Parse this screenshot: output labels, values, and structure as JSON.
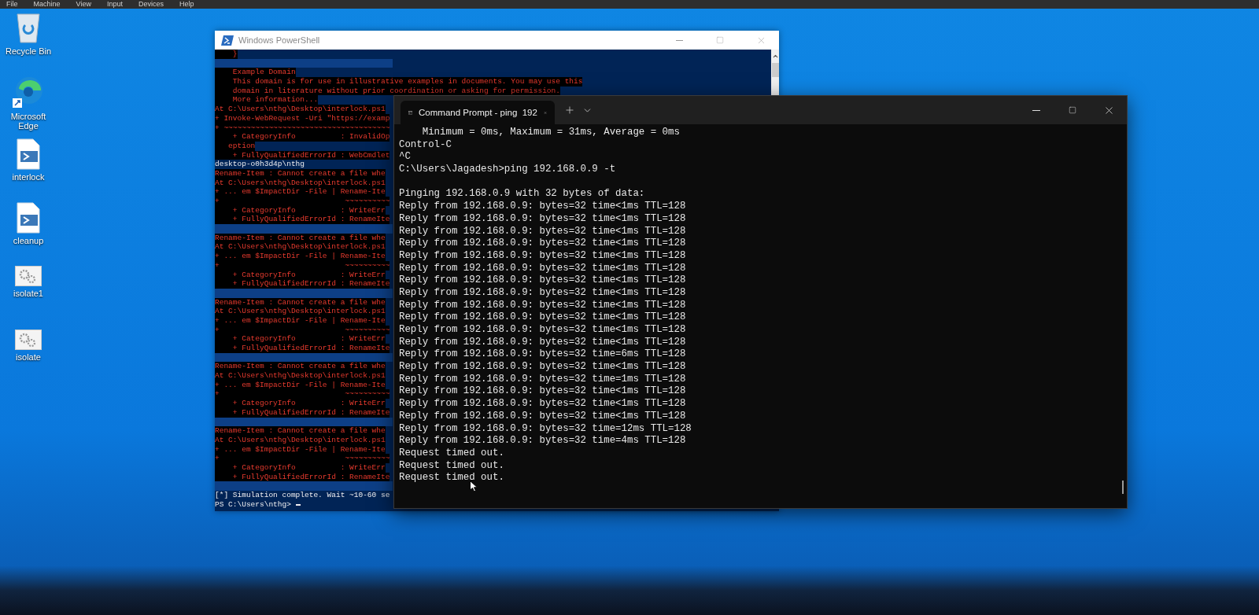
{
  "menu_bar": [
    "File",
    "Machine",
    "View",
    "Input",
    "Devices",
    "Help"
  ],
  "desktop_icons": [
    {
      "label": "Recycle Bin",
      "kind": "recycle"
    },
    {
      "label": "Microsoft Edge",
      "kind": "browser"
    },
    {
      "label": "interlock",
      "kind": "script"
    },
    {
      "label": "cleanup",
      "kind": "script"
    },
    {
      "label": "isolate1",
      "kind": "program"
    },
    {
      "label": "isolate",
      "kind": "program"
    }
  ],
  "powershell": {
    "title": "Windows PowerShell",
    "lines": [
      {
        "kind": "error",
        "text": "    }"
      },
      {
        "kind": "blank"
      },
      {
        "kind": "error",
        "text": "    Example Domain"
      },
      {
        "kind": "error",
        "text": "    This domain is for use in illustrative examples in documents. You may use this"
      },
      {
        "kind": "error",
        "text": "    domain in literature without prior coordination or asking for permission."
      },
      {
        "kind": "error",
        "text": "    More information..."
      },
      {
        "kind": "error",
        "text": "At C:\\Users\\nthg\\Desktop\\interlock.ps1"
      },
      {
        "kind": "error",
        "text": "+ Invoke-WebRequest -Uri \"https://examp"
      },
      {
        "kind": "error",
        "text": "+ ~~~~~~~~~~~~~~~~~~~~~~~~~~~~~~~~~~~~~"
      },
      {
        "kind": "error",
        "text": "    + CategoryInfo          : InvalidOp"
      },
      {
        "kind": "error",
        "text": "   eption"
      },
      {
        "kind": "error",
        "text": "    + FullyQualifiedErrorId : WebCmdlet"
      },
      {
        "kind": "output",
        "text": "desktop-o0h3d4p\\nthg"
      },
      {
        "kind": "error",
        "text": "Rename-Item : Cannot create a file whe"
      },
      {
        "kind": "error",
        "text": "At C:\\Users\\nthg\\Desktop\\interlock.ps1"
      },
      {
        "kind": "error",
        "text": "+ ... em $ImpactDir -File | Rename-Ite"
      },
      {
        "kind": "error",
        "text": "+                            ~~~~~~~~~~"
      },
      {
        "kind": "error",
        "text": "    + CategoryInfo          : WriteErr"
      },
      {
        "kind": "error",
        "text": "    + FullyQualifiedErrorId : RenameIte"
      },
      {
        "kind": "blank"
      },
      {
        "kind": "error",
        "text": "Rename-Item : Cannot create a file whe"
      },
      {
        "kind": "error",
        "text": "At C:\\Users\\nthg\\Desktop\\interlock.ps1"
      },
      {
        "kind": "error",
        "text": "+ ... em $ImpactDir -File | Rename-Ite"
      },
      {
        "kind": "error",
        "text": "+                            ~~~~~~~~~~"
      },
      {
        "kind": "error",
        "text": "    + CategoryInfo          : WriteErr"
      },
      {
        "kind": "error",
        "text": "    + FullyQualifiedErrorId : RenameIte"
      },
      {
        "kind": "blank"
      },
      {
        "kind": "error",
        "text": "Rename-Item : Cannot create a file whe"
      },
      {
        "kind": "error",
        "text": "At C:\\Users\\nthg\\Desktop\\interlock.ps1"
      },
      {
        "kind": "error",
        "text": "+ ... em $ImpactDir -File | Rename-Ite"
      },
      {
        "kind": "error",
        "text": "+                            ~~~~~~~~~~"
      },
      {
        "kind": "error",
        "text": "    + CategoryInfo          : WriteErr"
      },
      {
        "kind": "error",
        "text": "    + FullyQualifiedErrorId : RenameIte"
      },
      {
        "kind": "blank"
      },
      {
        "kind": "error",
        "text": "Rename-Item : Cannot create a file whe"
      },
      {
        "kind": "error",
        "text": "At C:\\Users\\nthg\\Desktop\\interlock.ps1"
      },
      {
        "kind": "error",
        "text": "+ ... em $ImpactDir -File | Rename-Ite"
      },
      {
        "kind": "error",
        "text": "+                            ~~~~~~~~~~"
      },
      {
        "kind": "error",
        "text": "    + CategoryInfo          : WriteErr"
      },
      {
        "kind": "error",
        "text": "    + FullyQualifiedErrorId : RenameIte"
      },
      {
        "kind": "blank"
      },
      {
        "kind": "error",
        "text": "Rename-Item : Cannot create a file whe"
      },
      {
        "kind": "error",
        "text": "At C:\\Users\\nthg\\Desktop\\interlock.ps1"
      },
      {
        "kind": "error",
        "text": "+ ... em $ImpactDir -File | Rename-Ite"
      },
      {
        "kind": "error",
        "text": "+                            ~~~~~~~~~~"
      },
      {
        "kind": "error",
        "text": "    + CategoryInfo          : WriteErr"
      },
      {
        "kind": "error",
        "text": "    + FullyQualifiedErrorId : RenameIte"
      },
      {
        "kind": "blank"
      },
      {
        "kind": "output",
        "text": "[*] Simulation complete. Wait ~10-60 se"
      },
      {
        "kind": "prompt",
        "text": "PS C:\\Users\\nthg>"
      }
    ]
  },
  "command_prompt": {
    "tab_title": "Command Prompt - ping  192",
    "lines": [
      {
        "kind": "text",
        "text": "    Minimum = 0ms, Maximum = 31ms, Average = 0ms"
      },
      {
        "kind": "text",
        "text": "Control-C"
      },
      {
        "kind": "text",
        "text": "^C"
      },
      {
        "kind": "text",
        "text": "C:\\Users\\Jagadesh>ping 192.168.0.9 -t"
      },
      {
        "kind": "blank"
      },
      {
        "kind": "text",
        "text": "Pinging 192.168.0.9 with 32 bytes of data:"
      },
      {
        "kind": "text",
        "text": "Reply from 192.168.0.9: bytes=32 time<1ms TTL=128"
      },
      {
        "kind": "text",
        "text": "Reply from 192.168.0.9: bytes=32 time<1ms TTL=128"
      },
      {
        "kind": "text",
        "text": "Reply from 192.168.0.9: bytes=32 time<1ms TTL=128"
      },
      {
        "kind": "text",
        "text": "Reply from 192.168.0.9: bytes=32 time<1ms TTL=128"
      },
      {
        "kind": "text",
        "text": "Reply from 192.168.0.9: bytes=32 time<1ms TTL=128"
      },
      {
        "kind": "text",
        "text": "Reply from 192.168.0.9: bytes=32 time<1ms TTL=128"
      },
      {
        "kind": "text",
        "text": "Reply from 192.168.0.9: bytes=32 time<1ms TTL=128"
      },
      {
        "kind": "text",
        "text": "Reply from 192.168.0.9: bytes=32 time<1ms TTL=128"
      },
      {
        "kind": "text",
        "text": "Reply from 192.168.0.9: bytes=32 time<1ms TTL=128"
      },
      {
        "kind": "text",
        "text": "Reply from 192.168.0.9: bytes=32 time<1ms TTL=128"
      },
      {
        "kind": "text",
        "text": "Reply from 192.168.0.9: bytes=32 time<1ms TTL=128"
      },
      {
        "kind": "text",
        "text": "Reply from 192.168.0.9: bytes=32 time<1ms TTL=128"
      },
      {
        "kind": "text",
        "text": "Reply from 192.168.0.9: bytes=32 time=6ms TTL=128"
      },
      {
        "kind": "text",
        "text": "Reply from 192.168.0.9: bytes=32 time<1ms TTL=128"
      },
      {
        "kind": "text",
        "text": "Reply from 192.168.0.9: bytes=32 time=1ms TTL=128"
      },
      {
        "kind": "text",
        "text": "Reply from 192.168.0.9: bytes=32 time<1ms TTL=128"
      },
      {
        "kind": "text",
        "text": "Reply from 192.168.0.9: bytes=32 time<1ms TTL=128"
      },
      {
        "kind": "text",
        "text": "Reply from 192.168.0.9: bytes=32 time<1ms TTL=128"
      },
      {
        "kind": "text",
        "text": "Reply from 192.168.0.9: bytes=32 time=12ms TTL=128"
      },
      {
        "kind": "text",
        "text": "Reply from 192.168.0.9: bytes=32 time=4ms TTL=128"
      },
      {
        "kind": "text",
        "text": "Request timed out."
      },
      {
        "kind": "text",
        "text": "Request timed out."
      },
      {
        "kind": "text",
        "text": "Request timed out."
      }
    ]
  }
}
